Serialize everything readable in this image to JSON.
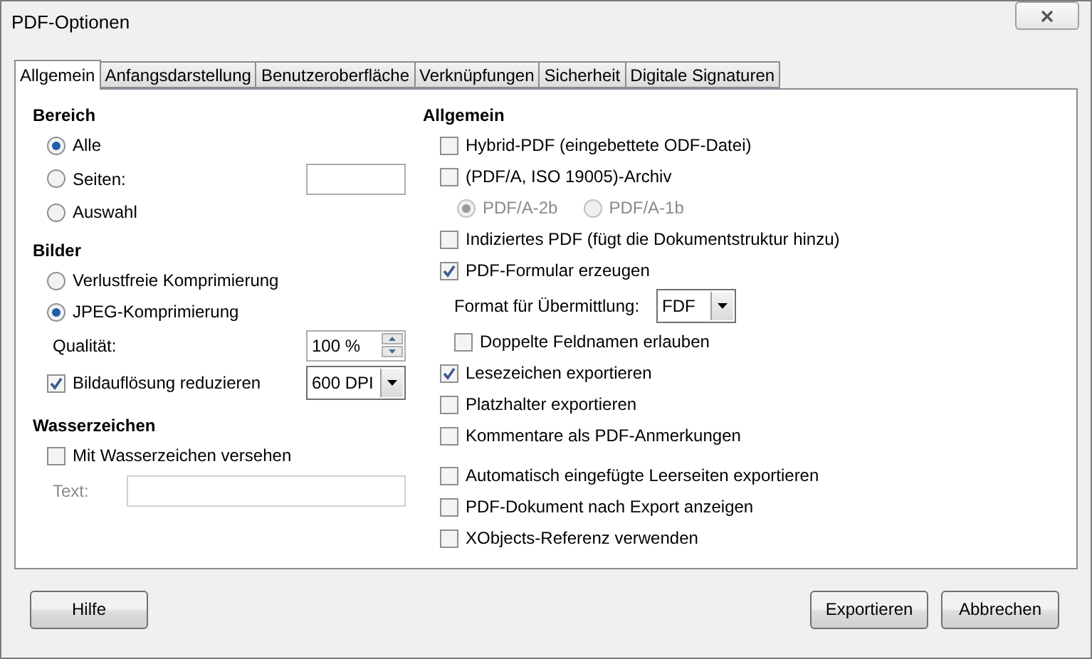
{
  "window": {
    "title": "PDF-Optionen"
  },
  "tabs": [
    {
      "label": "Allgemein",
      "selected": true
    },
    {
      "label": "Anfangsdarstellung",
      "selected": false
    },
    {
      "label": "Benutzeroberfläche",
      "selected": false
    },
    {
      "label": "Verknüpfungen",
      "selected": false
    },
    {
      "label": "Sicherheit",
      "selected": false
    },
    {
      "label": "Digitale Signaturen",
      "selected": false
    }
  ],
  "left_sections": [
    {
      "heading": "Bereich",
      "items": [
        {
          "kind": "radio",
          "label": "Alle",
          "selected": true
        },
        {
          "kind": "radio_field",
          "label": "Seiten:",
          "selected": false
        },
        {
          "kind": "radio",
          "label": "Auswahl",
          "selected": false
        }
      ]
    },
    {
      "heading": "Bilder",
      "items": [
        {
          "kind": "radio",
          "label": "Verlustfreie Komprimierung",
          "selected": false
        },
        {
          "kind": "radio",
          "label": "JPEG-Komprimierung",
          "selected": true
        },
        {
          "kind": "spin",
          "label": "Qualität:",
          "value": "100 %"
        },
        {
          "kind": "checkbox_select",
          "label": "Bildauflösung reduzieren",
          "checked": true,
          "value": "600 DPI"
        }
      ]
    },
    {
      "heading": "Wasserzeichen",
      "items": [
        {
          "kind": "checkbox",
          "label": "Mit Wasserzeichen versehen",
          "checked": false
        },
        {
          "kind": "text_field",
          "label": "Text:",
          "disabled": true
        }
      ]
    }
  ],
  "right_section": {
    "heading": "Allgemein",
    "groups": [
      [
        {
          "kind": "checkbox",
          "label": "Hybrid-PDF (eingebettete ODF-Datei)",
          "checked": false
        },
        {
          "kind": "checkbox",
          "label": "(PDF/A, ISO 19005)-Archiv",
          "checked": false,
          "children": [
            {
              "kind": "radio_pair",
              "disabled": true,
              "options": [
                {
                  "label": "PDF/A-2b",
                  "selected": true
                },
                {
                  "label": "PDF/A-1b",
                  "selected": false
                }
              ]
            }
          ]
        },
        {
          "kind": "checkbox",
          "label": "Indiziertes PDF (fügt die Dokumentstruktur hinzu)",
          "checked": false
        },
        {
          "kind": "checkbox",
          "label": "PDF-Formular erzeugen",
          "checked": true,
          "children": [
            {
              "kind": "select",
              "label": "Format für Übermittlung:",
              "value": "FDF"
            },
            {
              "kind": "checkbox",
              "label": "Doppelte Feldnamen erlauben",
              "checked": false
            }
          ]
        },
        {
          "kind": "checkbox",
          "label": "Lesezeichen exportieren",
          "checked": true
        },
        {
          "kind": "checkbox",
          "label": "Platzhalter exportieren",
          "checked": false
        },
        {
          "kind": "checkbox",
          "label": "Kommentare als PDF-Anmerkungen",
          "checked": false
        }
      ],
      [
        {
          "kind": "checkbox",
          "label": "Automatisch eingefügte Leerseiten exportieren",
          "checked": false
        },
        {
          "kind": "checkbox",
          "label": "PDF-Dokument nach Export anzeigen",
          "checked": false
        },
        {
          "kind": "checkbox",
          "label": "XObjects-Referenz verwenden",
          "checked": false
        }
      ]
    ]
  },
  "footer": {
    "left_buttons": [
      "Hilfe"
    ],
    "right_buttons": [
      "Exportieren",
      "Abbrechen"
    ]
  }
}
